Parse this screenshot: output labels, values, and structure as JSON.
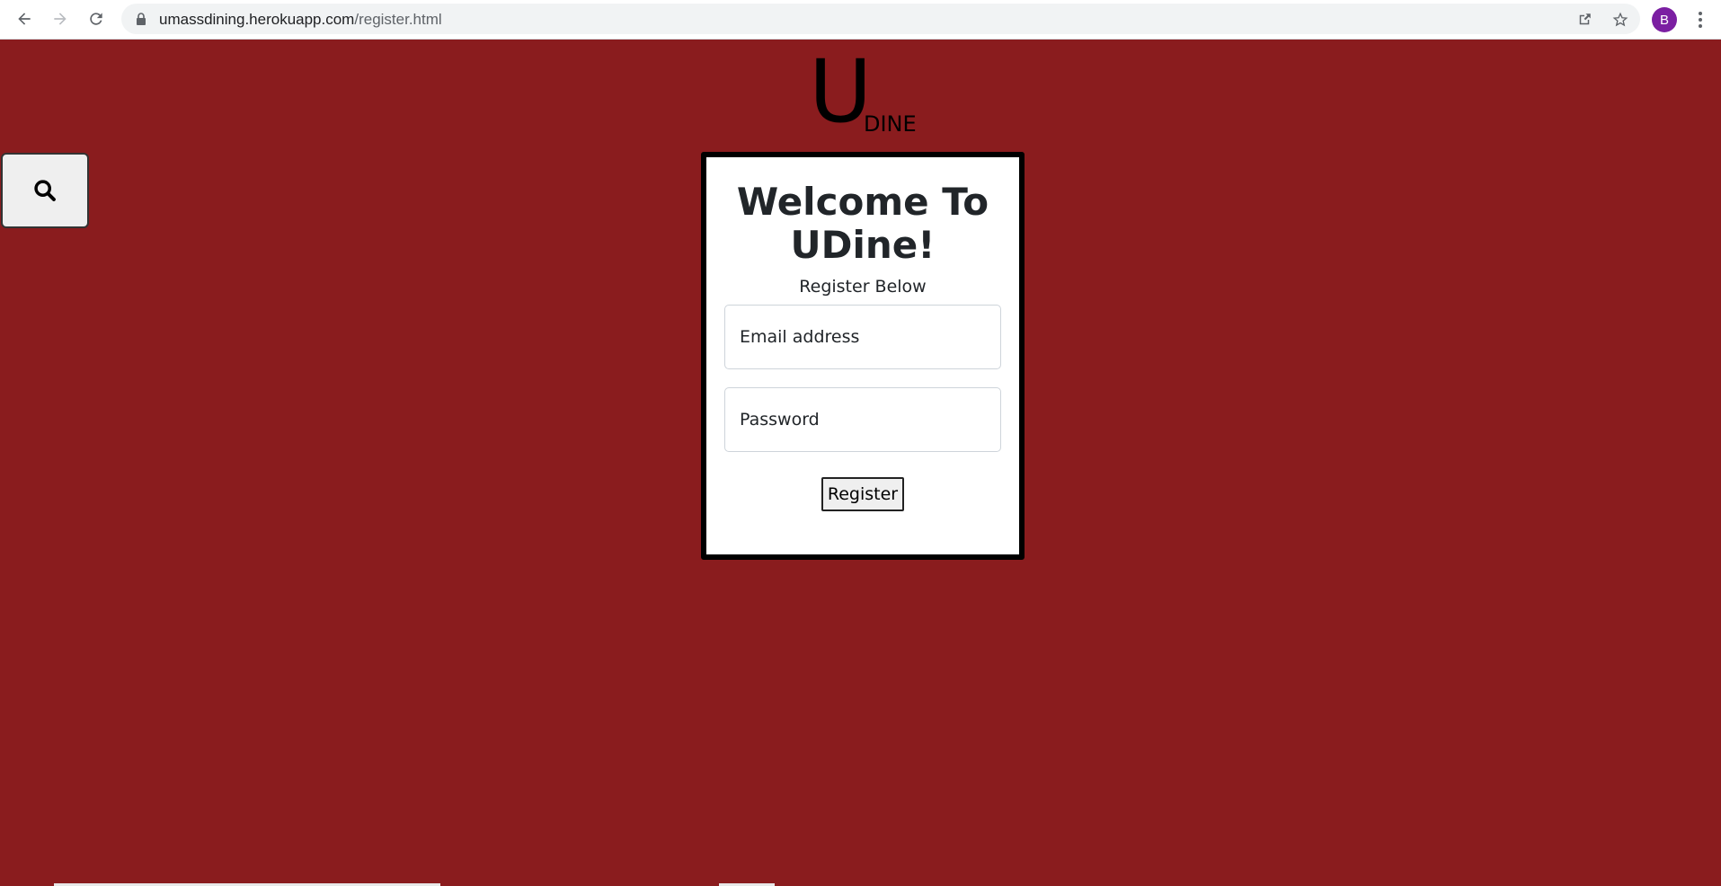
{
  "browser": {
    "url_host": "umassdining.herokuapp.com",
    "url_path": "/register.html",
    "profile_initial": "B"
  },
  "logo": {
    "letter": "U",
    "suffix": "DINE"
  },
  "card": {
    "title": "Welcome To UDine!",
    "subtitle": "Register Below",
    "email_placeholder": "Email address",
    "password_placeholder": "Password",
    "register_label": "Register"
  },
  "colors": {
    "background": "#8a1c1e",
    "card": "#ffffff",
    "card_border": "#000000"
  }
}
